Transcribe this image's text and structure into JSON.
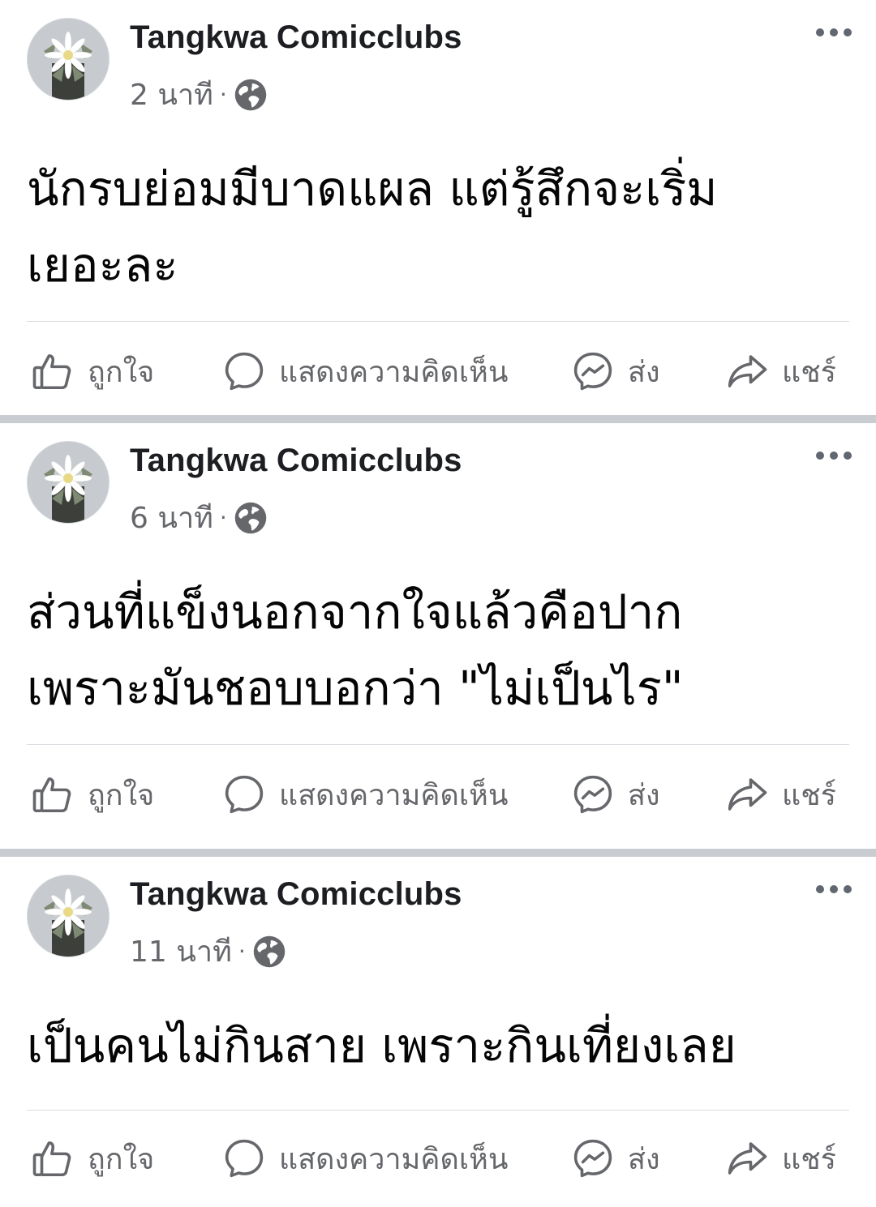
{
  "posts": [
    {
      "author": "Tangkwa Comicclubs",
      "time": "2 นาที",
      "separator": "·",
      "text": "นักรบย่อมมีบาดแผล แต่รู้สึกจะเริ่ม\nเยอะละ",
      "actions": {
        "like": "ถูกใจ",
        "comment": "แสดงความคิดเห็น",
        "send": "ส่ง",
        "share": "แชร์"
      }
    },
    {
      "author": "Tangkwa Comicclubs",
      "time": "6 นาที",
      "separator": "·",
      "text": "ส่วนที่แข็งนอกจากใจแล้วคือปาก\nเพราะมันชอบบอกว่า \"ไม่เป็นไร\"",
      "actions": {
        "like": "ถูกใจ",
        "comment": "แสดงความคิดเห็น",
        "send": "ส่ง",
        "share": "แชร์"
      }
    },
    {
      "author": "Tangkwa Comicclubs",
      "time": "11 นาที",
      "separator": "·",
      "text": "เป็นคนไม่กินสาย เพราะกินเที่ยงเลย",
      "actions": {
        "like": "ถูกใจ",
        "comment": "แสดงความคิดเห็น",
        "send": "ส่ง",
        "share": "แชร์"
      }
    }
  ],
  "colors": {
    "text_primary": "#050505",
    "text_secondary": "#65676b",
    "separator_bg": "#c9ccd1"
  },
  "icons": [
    "more-options-icon",
    "globe-icon",
    "like-icon",
    "comment-icon",
    "messenger-icon",
    "share-icon",
    "avatar-flower"
  ]
}
